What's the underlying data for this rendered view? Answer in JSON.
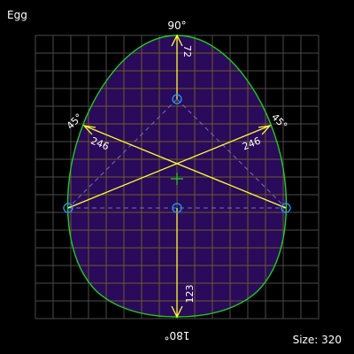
{
  "title": "Egg",
  "size_label": "Size: 320",
  "colors": {
    "background": "#000000",
    "grid": "#4a4a4a",
    "egg_fill": "#2a0a5a",
    "egg_grid": "#6e5a2a",
    "outline": "#22cc22",
    "construction": "#ffff33",
    "dashed": "#7070c0",
    "points": "#1aa0ff",
    "center_cross": "#22cc22",
    "text": "#ffffff"
  },
  "angles": {
    "top": "90°",
    "bottom": "180°",
    "left": "45°",
    "right": "45°"
  },
  "dimensions": {
    "top": "72",
    "left": "246",
    "right": "246",
    "bottom": "123"
  },
  "icons": [
    "center-point-icon",
    "top-point-icon",
    "left-point-icon",
    "right-point-icon",
    "center-cross-icon"
  ]
}
